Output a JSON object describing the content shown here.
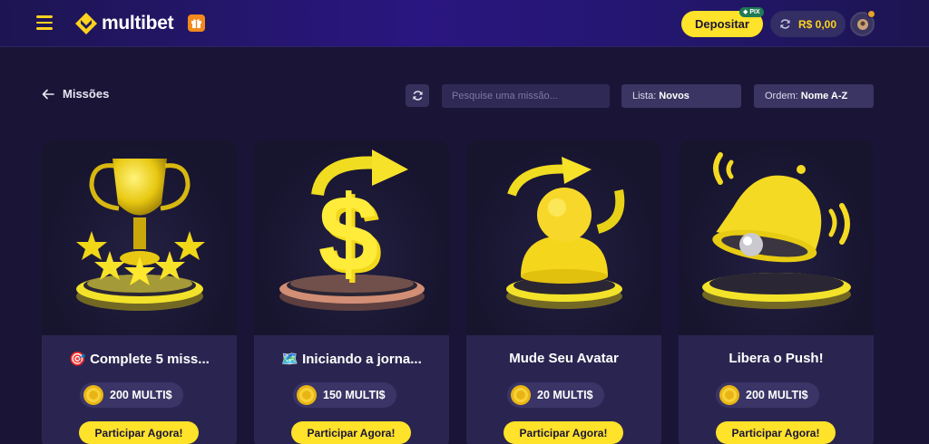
{
  "header": {
    "brand": "multibet",
    "deposit_label": "Depositar",
    "pix_badge": "PIX",
    "balance": "R$ 0,00"
  },
  "toolbar": {
    "back_label": "Missões",
    "search_placeholder": "Pesquise uma missão...",
    "list_label": "Lista:",
    "list_value": "Novos",
    "order_label": "Ordem:",
    "order_value": "Nome A-Z"
  },
  "missions": [
    {
      "emoji": "🎯",
      "title": "Complete 5 miss...",
      "reward": "200 MULTI$",
      "cta": "Participar Agora!",
      "image": "trophy-icon"
    },
    {
      "emoji": "🗺️",
      "title": "Iniciando a jorna...",
      "reward": "150 MULTI$",
      "cta": "Participar Agora!",
      "image": "dollar-icon"
    },
    {
      "emoji": "",
      "title": "Mude Seu Avatar",
      "reward": "20 MULTI$",
      "cta": "Participar Agora!",
      "image": "avatar-icon"
    },
    {
      "emoji": "",
      "title": "Libera o Push!",
      "reward": "200 MULTI$",
      "cta": "Participar Agora!",
      "image": "bell-icon"
    }
  ],
  "colors": {
    "accent": "#ffe22a",
    "background": "#1a1536",
    "card": "#2a2550"
  }
}
